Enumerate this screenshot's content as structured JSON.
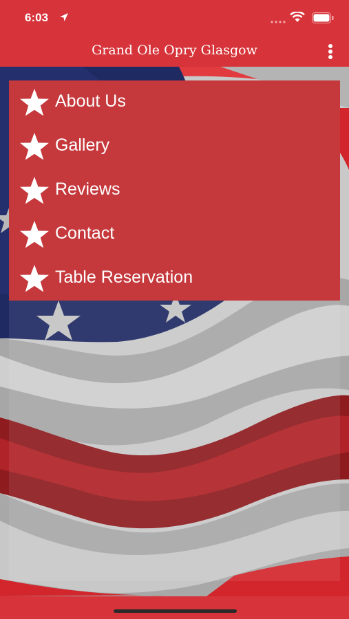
{
  "status_bar": {
    "time": "6:03",
    "icons": [
      "location-arrow-icon",
      "signal-dots-icon",
      "wifi-icon",
      "battery-icon"
    ]
  },
  "app_bar": {
    "title": "Grand Ole Opry Glasgow",
    "more_icon": "more-vertical-icon"
  },
  "menu": {
    "items": [
      {
        "label": "About Us",
        "icon": "star-icon"
      },
      {
        "label": "Gallery",
        "icon": "star-icon"
      },
      {
        "label": "Reviews",
        "icon": "star-icon"
      },
      {
        "label": "Contact",
        "icon": "star-icon"
      },
      {
        "label": "Table Reservation",
        "icon": "star-icon"
      }
    ]
  },
  "colors": {
    "brand_red": "#d6343a",
    "menu_panel": "#c5383c",
    "flag_blue": "#1f2a63",
    "flag_stripe_red": "#8e1c1f",
    "flag_gray": "#b5b5b5"
  },
  "background_image": "waving-american-flag"
}
